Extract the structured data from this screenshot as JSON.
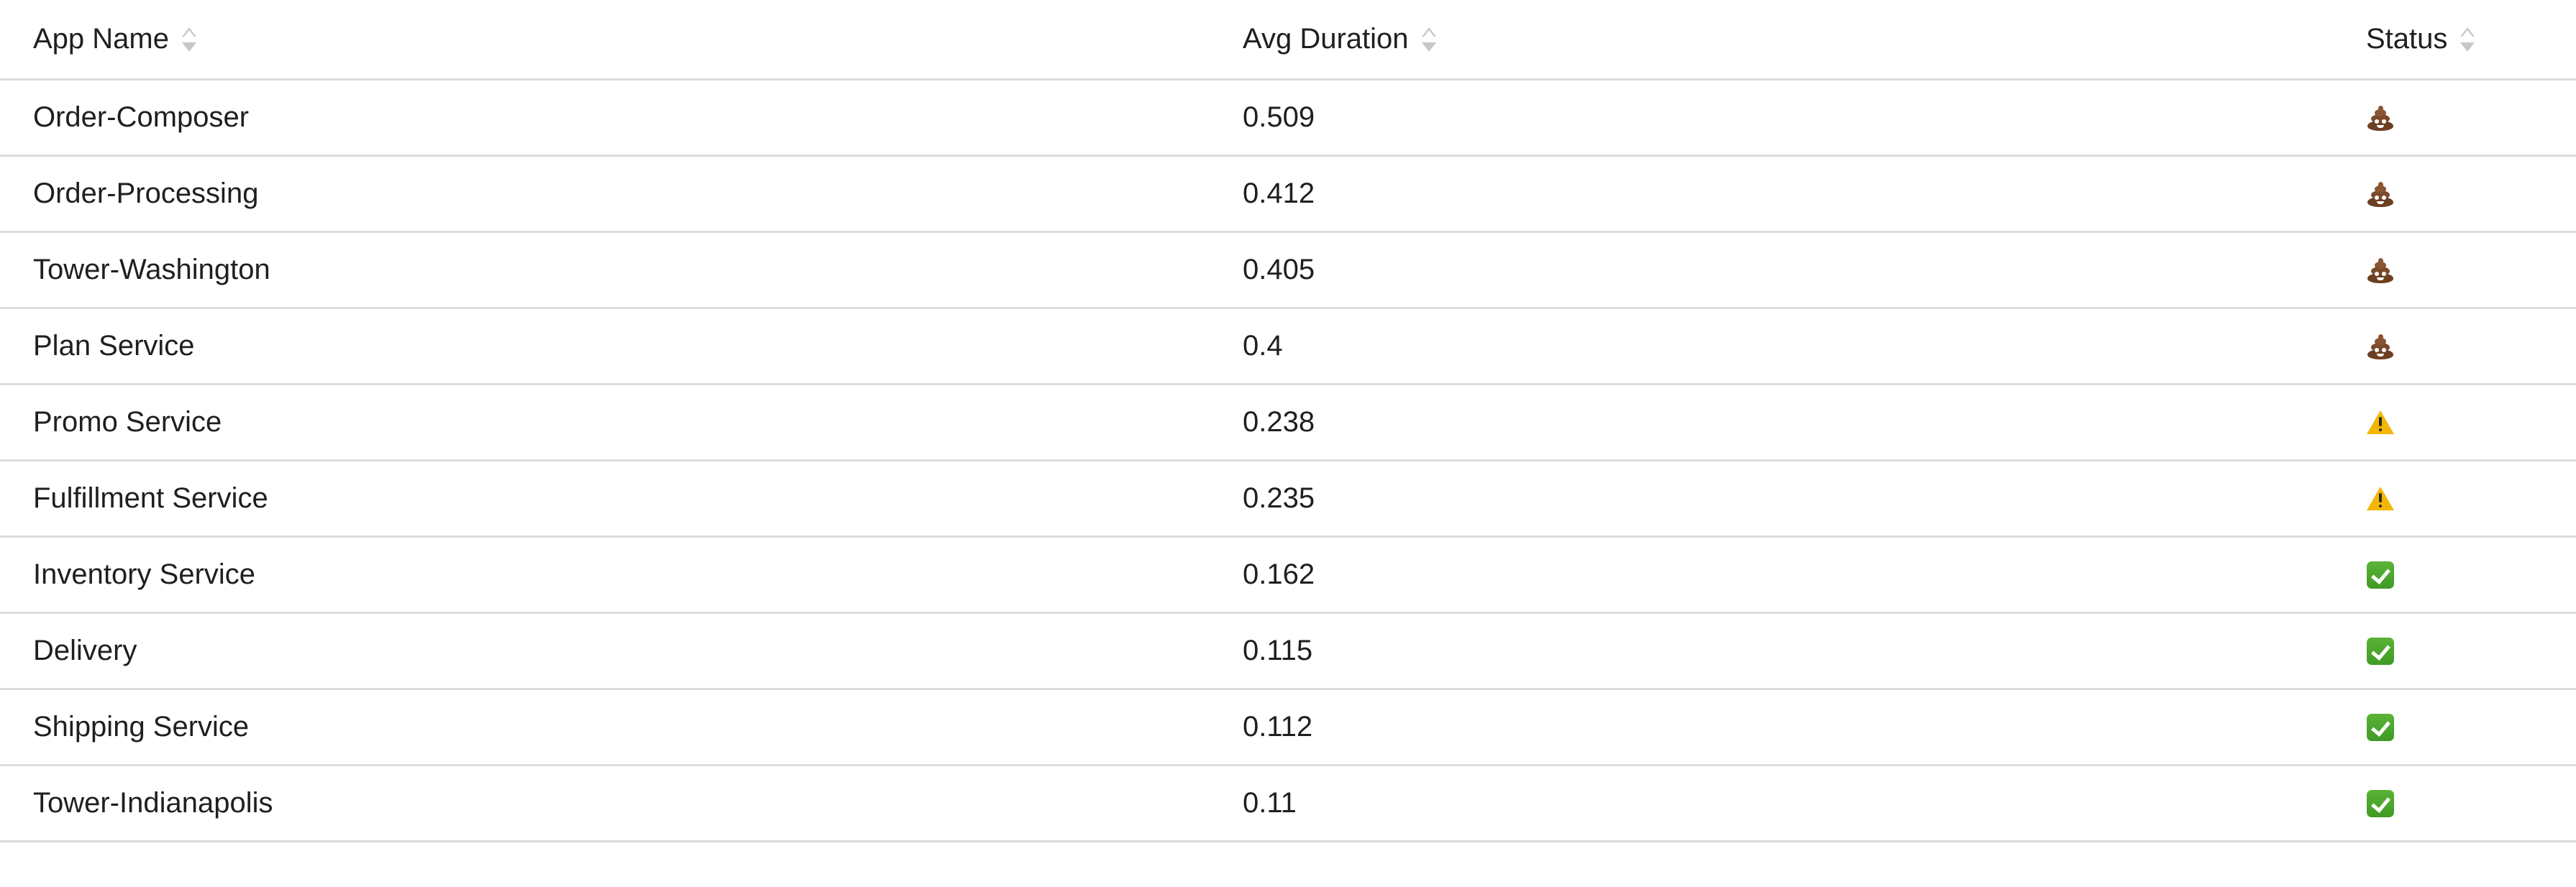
{
  "table": {
    "headers": {
      "app_name": "App Name",
      "avg_duration": "Avg Duration",
      "status": "Status"
    },
    "rows": [
      {
        "app_name": "Order-Composer",
        "avg_duration": "0.509",
        "status": "poop-icon"
      },
      {
        "app_name": "Order-Processing",
        "avg_duration": "0.412",
        "status": "poop-icon"
      },
      {
        "app_name": "Tower-Washington",
        "avg_duration": "0.405",
        "status": "poop-icon"
      },
      {
        "app_name": "Plan Service",
        "avg_duration": "0.4",
        "status": "poop-icon"
      },
      {
        "app_name": "Promo Service",
        "avg_duration": "0.238",
        "status": "warning-icon"
      },
      {
        "app_name": "Fulfillment Service",
        "avg_duration": "0.235",
        "status": "warning-icon"
      },
      {
        "app_name": "Inventory Service",
        "avg_duration": "0.162",
        "status": "check-icon"
      },
      {
        "app_name": "Delivery",
        "avg_duration": "0.115",
        "status": "check-icon"
      },
      {
        "app_name": "Shipping Service",
        "avg_duration": "0.112",
        "status": "check-icon"
      },
      {
        "app_name": "Tower-Indianapolis",
        "avg_duration": "0.11",
        "status": "check-icon"
      }
    ]
  },
  "icons": {
    "sort": "sort-icon",
    "status_types": [
      "poop-icon",
      "warning-icon",
      "check-icon"
    ]
  },
  "colors": {
    "border": "#dcdcdc",
    "sort_icon": "#c8c8c8",
    "warning": "#f2b705",
    "check": "#4aa52c",
    "poop": "#7a4a2a"
  }
}
